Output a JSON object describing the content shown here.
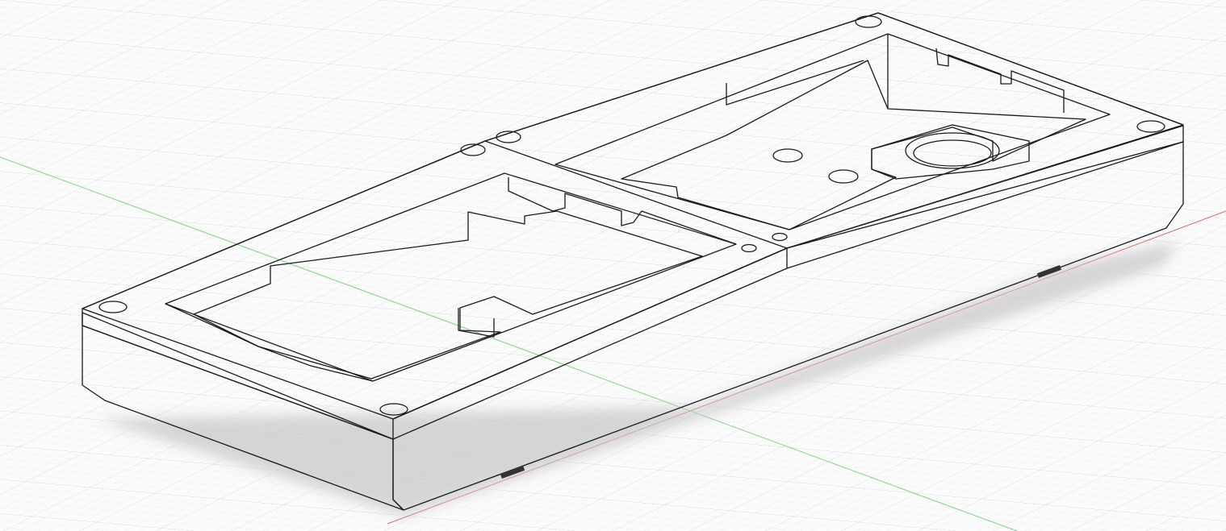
{
  "viewport": {
    "background_color": "#fbfbfb",
    "grid_minor_color": "#e3e6ea",
    "grid_major_color": "#ccd1d6",
    "axis_x_color": "#e06666",
    "axis_y_color": "#7cd67c"
  },
  "model": {
    "body_color": "#8a8981",
    "top_face_color": "#858479",
    "side_face_color": "#77766e",
    "front_face_color": "#6b6a63",
    "pocket_floor_color": "#7d7c72",
    "pocket_wall_color": "#696860",
    "edge_color": "#1a1a1a",
    "shadow_color": "#cfcfcf"
  },
  "icons": {
    "screw_hole": "countersunk-hole-icon"
  }
}
